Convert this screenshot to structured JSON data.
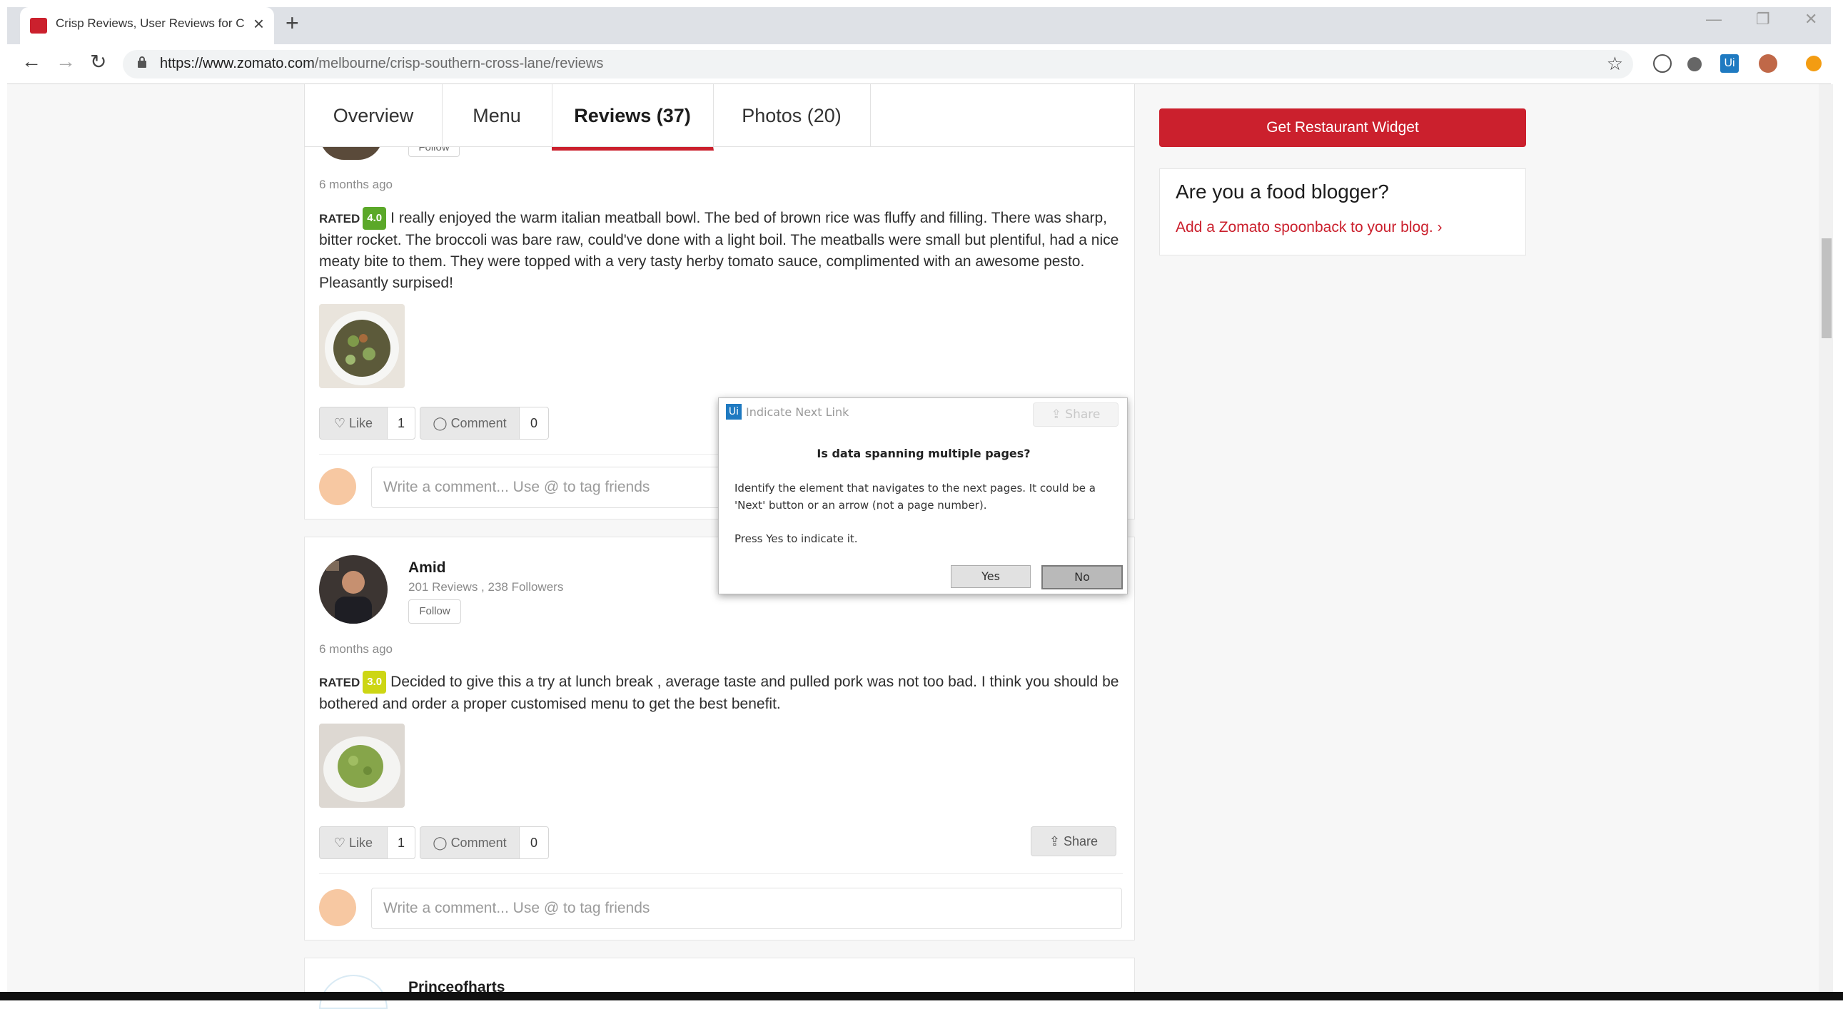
{
  "browser": {
    "tab_title": "Crisp Reviews, User Reviews for C",
    "url_domain": "https://www.zomato.com",
    "url_path": "/melbourne/crisp-southern-cross-lane/reviews"
  },
  "nav_tabs": [
    {
      "label": "Overview"
    },
    {
      "label": "Menu"
    },
    {
      "label": "Reviews (37)"
    },
    {
      "label": "Photos (20)"
    }
  ],
  "reviews": [
    {
      "follow_label": "Follow",
      "time": "6 months ago",
      "rated_label": "RATED",
      "rating": "4.0",
      "rating_color": "#5ba829",
      "text": "I really enjoyed the warm italian meatball bowl. The bed of brown rice was fluffy and filling. There was sharp, bitter rocket. The broccoli was bare raw, could've done with a light boil. The meatballs were small but plentiful, had a nice meaty bite to them. They were topped with a very tasty herby tomato sauce, complimented with an awesome pesto. Pleasantly surpised!",
      "like_label": "Like",
      "like_count": "1",
      "comment_label": "Comment",
      "comment_count": "0",
      "share_label": "Share",
      "comment_placeholder": "Write a comment... Use @ to tag friends"
    },
    {
      "author": "Amid",
      "author_stats": "201 Reviews , 238 Followers",
      "follow_label": "Follow",
      "time": "6 months ago",
      "rated_label": "RATED",
      "rating": "3.0",
      "rating_color": "#cdd614",
      "text": "Decided to give this a try at lunch break , average taste and pulled pork was not too bad. I think you should be bothered and order a proper customised menu to get the best benefit.",
      "like_label": "Like",
      "like_count": "1",
      "comment_label": "Comment",
      "comment_count": "0",
      "share_label": "Share",
      "comment_placeholder": "Write a comment... Use @ to tag friends"
    },
    {
      "author": "Princeofharts"
    }
  ],
  "sidebar": {
    "widget_button": "Get Restaurant Widget",
    "blogger_title": "Are you a food blogger?",
    "blogger_link": "Add a Zomato spoonback to your blog. ›"
  },
  "dialog": {
    "logo": "Ui",
    "title": "Indicate Next Link",
    "share_label": "Share",
    "question": "Is data spanning multiple pages?",
    "body": "Identify the element that navigates to the next pages. It could be a 'Next' button or an arrow (not a page number).",
    "hint": "Press Yes to indicate it.",
    "yes_label": "Yes",
    "no_label": "No"
  },
  "colors": {
    "brand_red": "#cb202d",
    "uipath_blue": "#1f7ac1"
  }
}
